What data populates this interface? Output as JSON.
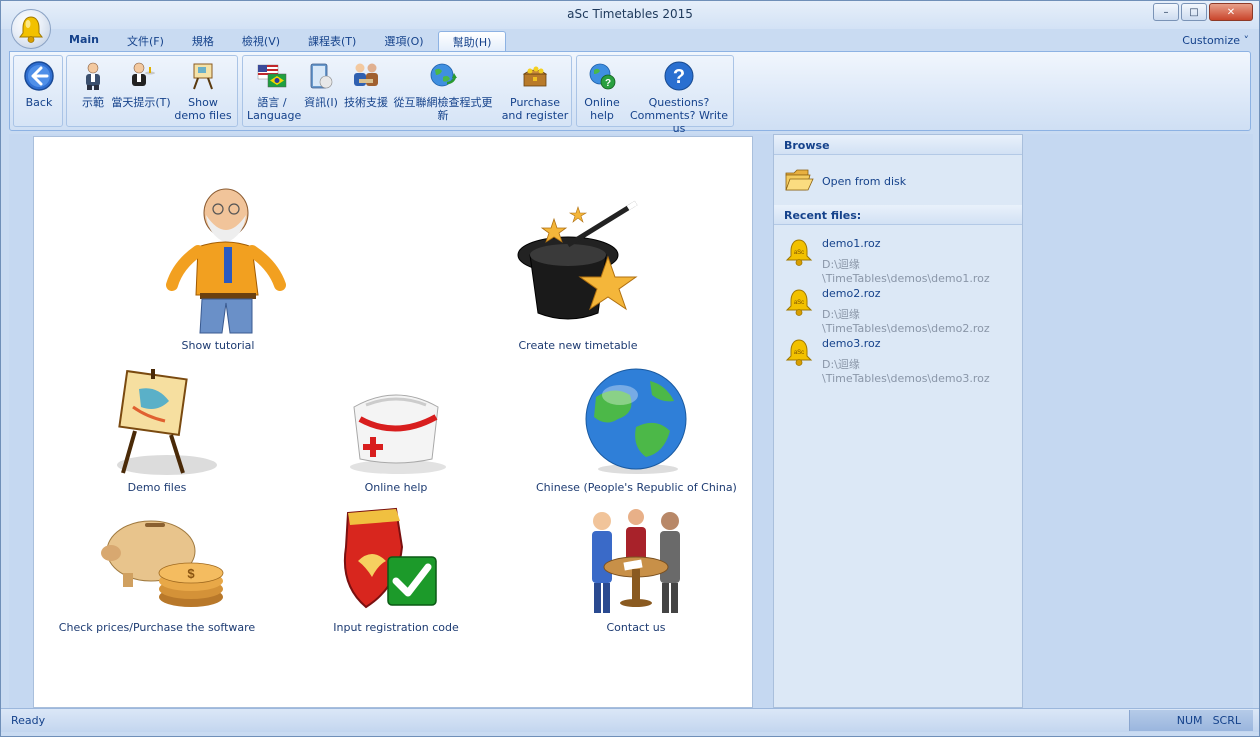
{
  "window": {
    "title": "aSc Timetables 2015",
    "minimize": "–",
    "maximize": "□",
    "close": "✕"
  },
  "tabs": [
    {
      "label": "Main"
    },
    {
      "label": "文件(F)"
    },
    {
      "label": "規格"
    },
    {
      "label": "檢視(V)"
    },
    {
      "label": "課程表(T)"
    },
    {
      "label": "選項(O)"
    },
    {
      "label": "幫助(H)"
    }
  ],
  "active_tab": "幫助(H)",
  "customize": "Customize ˅",
  "ribbon": {
    "back": "Back",
    "demo": "示範",
    "tip": "當天提示(T)",
    "show_demo_files": "Show demo files",
    "language": "語言 / Language",
    "info": "資訊(I)",
    "support": "技術支援",
    "update": "從互聯網檢查程式更新",
    "purchase": "Purchase and register",
    "online_help": "Online help",
    "questions": "Questions? Comments? Write us"
  },
  "tiles": {
    "show_tutorial": "Show tutorial",
    "create_timetable": "Create new timetable",
    "demo_files": "Demo files",
    "online_help": "Online help",
    "chinese": "Chinese (People's Republic of China)",
    "check_prices": "Check prices/Purchase the software",
    "registration": "Input registration code",
    "contact": "Contact us"
  },
  "side": {
    "browse": "Browse",
    "open_from_disk": "Open from disk",
    "recent_files": "Recent files:",
    "files": [
      {
        "name": "demo1.roz",
        "path": "D:\\迴缘\\TimeTables\\demos\\demo1.roz"
      },
      {
        "name": "demo2.roz",
        "path": "D:\\迴缘\\TimeTables\\demos\\demo2.roz"
      },
      {
        "name": "demo3.roz",
        "path": "D:\\迴缘\\TimeTables\\demos\\demo3.roz"
      }
    ]
  },
  "status": {
    "text": "Ready",
    "num": "NUM",
    "scrl": "SCRL"
  },
  "colors": {
    "accent": "#15428b",
    "frame": "#c5d8f1",
    "bell": "#f2c100"
  }
}
